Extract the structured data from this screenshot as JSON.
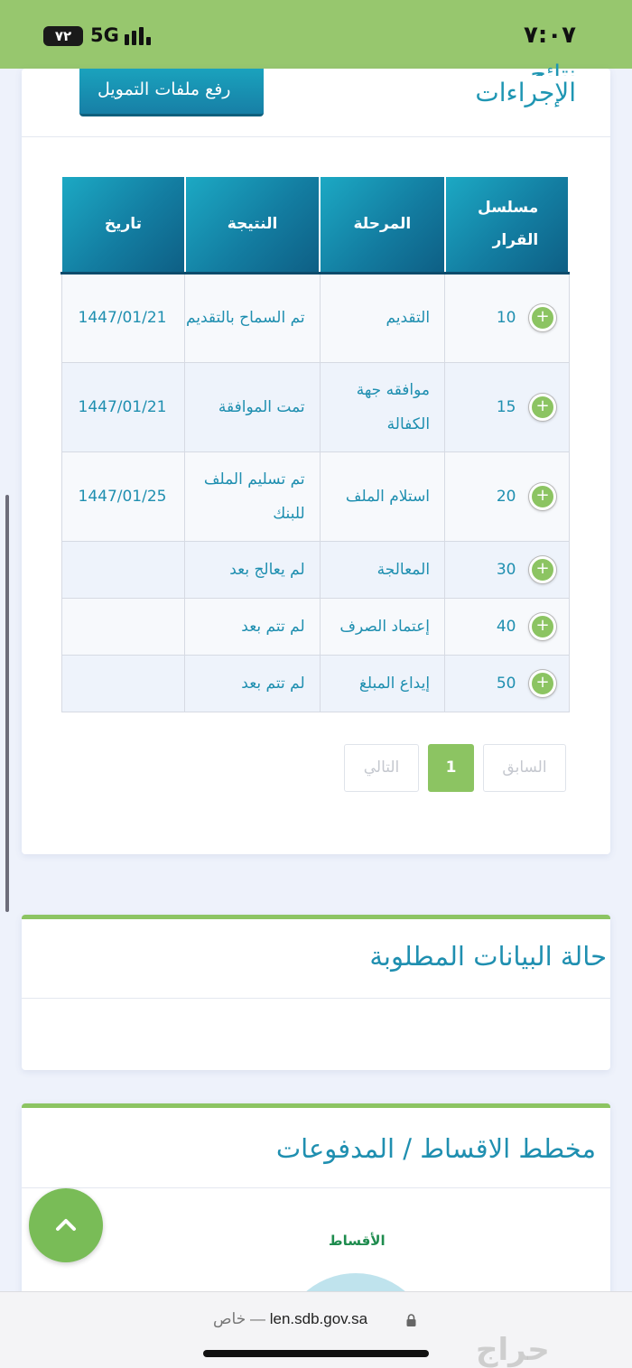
{
  "status_bar": {
    "time": "٧:٠٧",
    "battery": "٧٢",
    "network": "5G"
  },
  "procedures_card": {
    "title_line1": "نتائج",
    "title_line2": "الإجراءات",
    "upload_button": "رفع ملفات التمويل"
  },
  "table": {
    "headers": {
      "serial": "مسلسل القرار",
      "stage": "المرحلة",
      "result": "النتيجة",
      "date": "تاريخ"
    },
    "rows": [
      {
        "serial": "10",
        "stage": "التقديم",
        "result": "تم السماح بالتقديم",
        "date": "1447/01/21"
      },
      {
        "serial": "15",
        "stage": "موافقه جهة الكفالة",
        "result": "تمت الموافقة",
        "date": "1447/01/21"
      },
      {
        "serial": "20",
        "stage": "استلام الملف",
        "result": "تم تسليم الملف للبنك",
        "date": "1447/01/25"
      },
      {
        "serial": "30",
        "stage": "المعالجة",
        "result": "لم يعالج بعد",
        "date": ""
      },
      {
        "serial": "40",
        "stage": "إعتماد الصرف",
        "result": "لم تتم بعد",
        "date": ""
      },
      {
        "serial": "50",
        "stage": "إيداع المبلغ",
        "result": "لم تتم بعد",
        "date": ""
      }
    ],
    "plus_symbol": "+"
  },
  "pagination": {
    "next": "التالي",
    "current": "1",
    "previous": "السابق"
  },
  "required_data_card": {
    "title": "حالة البيانات المطلوبة"
  },
  "installments_card": {
    "title": "مخطط الاقساط / المدفوعات",
    "chart_label": "الأقساط"
  },
  "browser": {
    "url": "len.sdb.gov.sa",
    "private_label": "خاص",
    "separator": "—"
  },
  "watermark": "حراج",
  "colors": {
    "status_bar": "#97c76e",
    "accent_green": "#8cc462",
    "accent_blue": "#1f8fb0",
    "header_dark": "#0e5f85"
  }
}
